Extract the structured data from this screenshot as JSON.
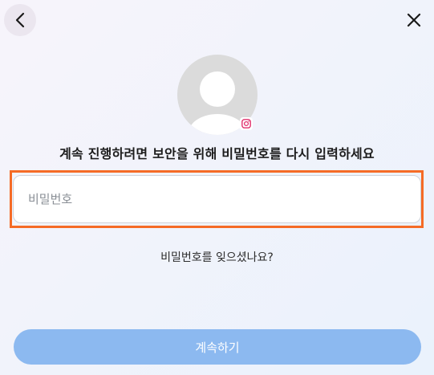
{
  "header": {
    "back_icon": "chevron-left-icon",
    "close_icon": "close-icon"
  },
  "profile": {
    "avatar_icon": "default-avatar-icon",
    "badge_icon": "instagram-icon",
    "badge_color": "#e1306c"
  },
  "prompt": {
    "text": "계속 진행하려면 보안을 위해 비밀번호를 다시 입력하세요"
  },
  "password": {
    "value": "",
    "placeholder": "비밀번호",
    "highlight_color": "#f56b26"
  },
  "forgot_password": {
    "label": "비밀번호를 잊으셨나요?"
  },
  "continue_button": {
    "label": "계속하기",
    "color": "#8cb9f0"
  }
}
